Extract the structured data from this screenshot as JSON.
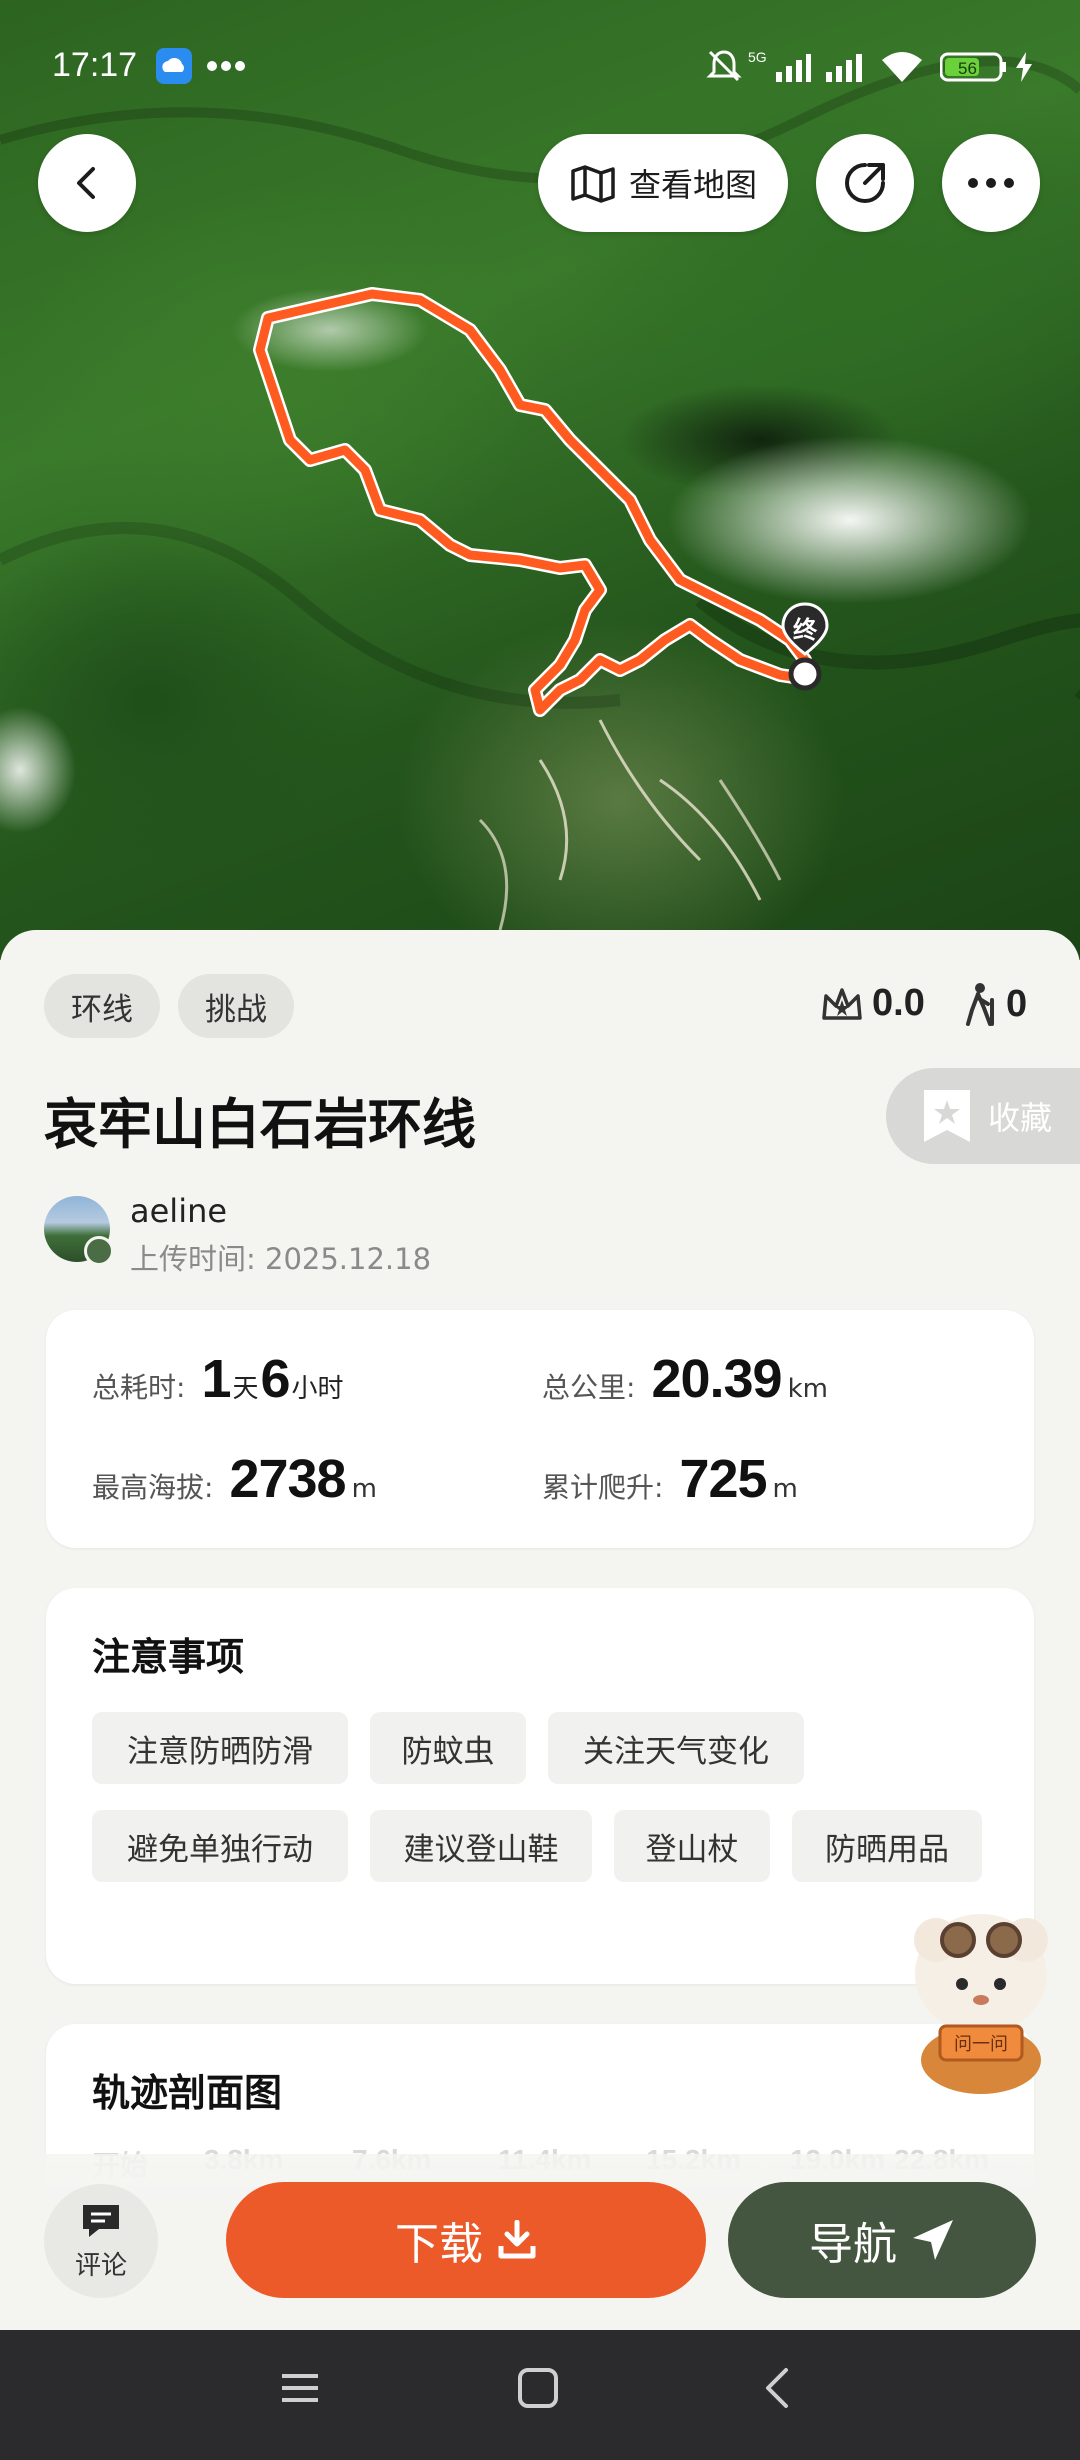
{
  "status_bar": {
    "time": "17:17",
    "network": "5G",
    "battery": "56"
  },
  "map": {
    "view_map_label": "查看地图",
    "end_marker": "终",
    "route_color": "#ff5a1f"
  },
  "tags": [
    "环线",
    "挑战"
  ],
  "stats_top": {
    "rating": "0.0",
    "hikers": "0"
  },
  "route": {
    "title": "哀牢山白石岩环线",
    "favorite_label": "收藏"
  },
  "author": {
    "name": "aeline",
    "upload_time": "上传时间: 2025.12.18"
  },
  "metrics": {
    "duration_label": "总耗时:",
    "duration_days": "1",
    "duration_days_unit": "天",
    "duration_hours": "6",
    "duration_hours_unit": "小时",
    "distance_label": "总公里:",
    "distance_value": "20.39",
    "distance_unit": "km",
    "max_alt_label": "最高海拔:",
    "max_alt_value": "2738",
    "max_alt_unit": "m",
    "climb_label": "累计爬升:",
    "climb_value": "725",
    "climb_unit": "m"
  },
  "notes": {
    "title": "注意事项",
    "items": [
      "注意防晒防滑",
      "防蚊虫",
      "关注天气变化",
      "避免单独行动",
      "建议登山鞋",
      "登山杖",
      "防晒用品"
    ]
  },
  "profile": {
    "title": "轨迹剖面图",
    "axis": [
      "开始",
      "3.8km",
      "7.6km",
      "11.4km",
      "15.2km",
      "19.0km",
      "22.8km"
    ]
  },
  "actions": {
    "comment_label": "评论",
    "download_label": "下载",
    "navigate_label": "导航"
  },
  "colors": {
    "accent": "#ec5a2a",
    "nav_green": "#445640"
  }
}
